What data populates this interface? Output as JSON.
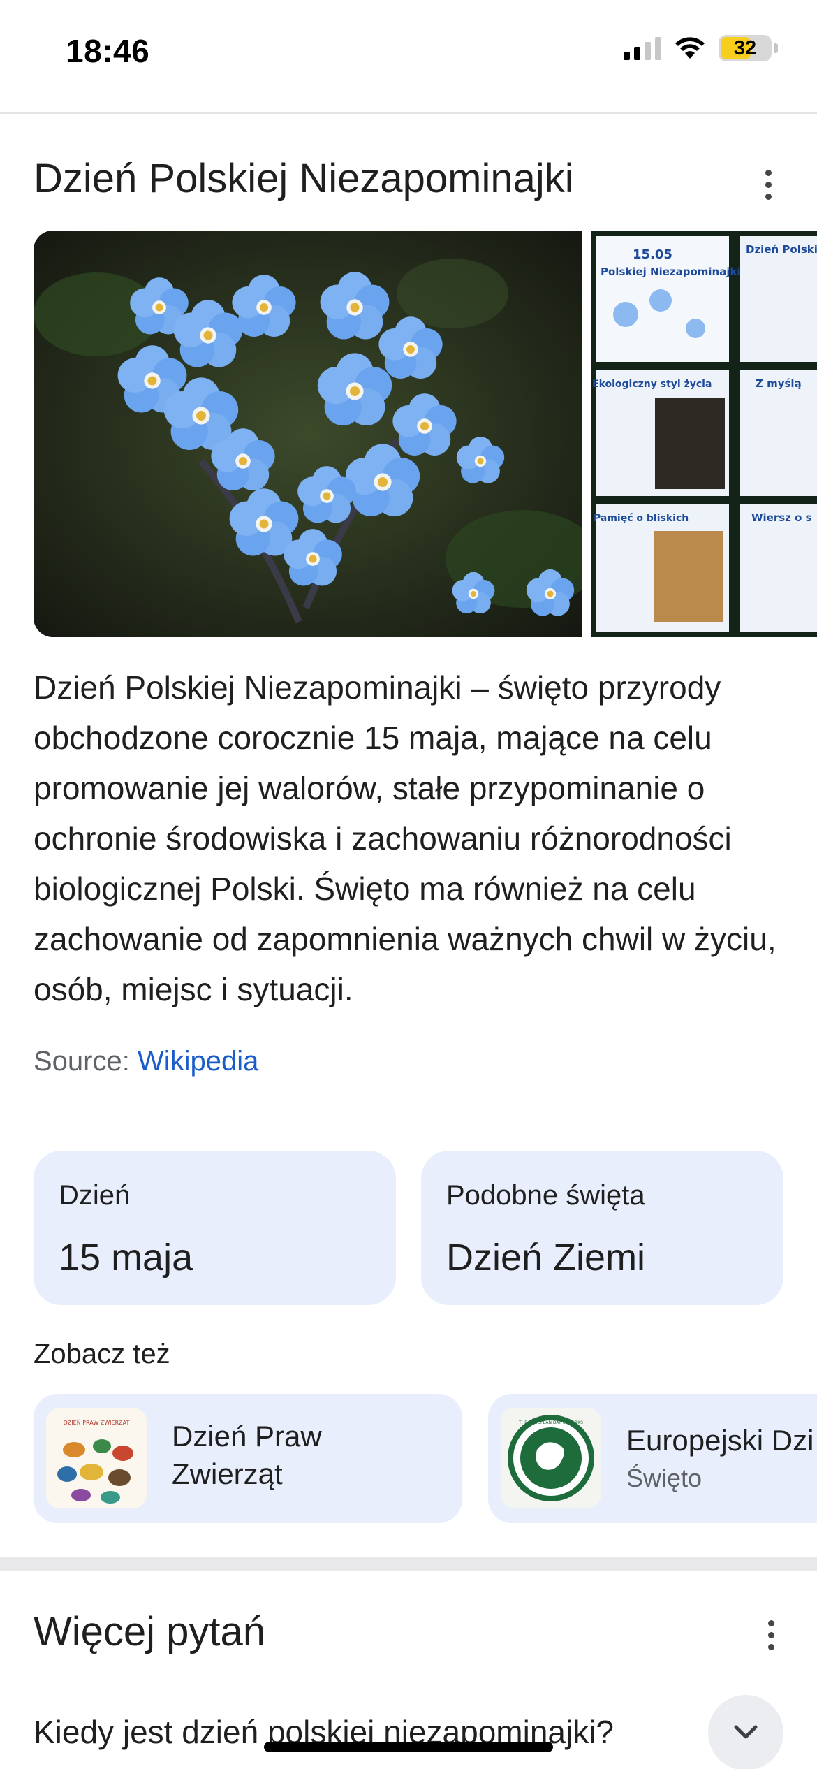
{
  "status_bar": {
    "time": "18:46",
    "battery": "32",
    "icons": [
      "cellular-signal-icon",
      "wifi-icon",
      "battery-icon"
    ]
  },
  "knowledge_panel": {
    "title": "Dzień Polskiej Niezapominajki",
    "images": [
      "forget-me-not heart",
      "15.05 Polskiej Niezapominajki"
    ],
    "poster_texts": [
      "15.05",
      "Polskiej Niezapominajki",
      "Dzień Polskiej",
      "Ekologiczny styl życia",
      "Z myślą",
      "Pamięć o bliskich",
      "Wiersz o s"
    ],
    "description": "Dzień Polskiej Niezapominajki – święto przyrody obchodzone corocznie 15 maja, mające na celu promowanie jej walorów, stałe przypominanie o ochronie środowiska i zachowaniu różnorodności biologicznej Polski. Święto ma również na celu zachowanie od zapomnienia ważnych chwil w życiu, osób, miejsc i sytuacji.",
    "source_label": "Source:",
    "source_link": "Wikipedia",
    "facts": [
      {
        "label": "Dzień",
        "value": "15 maja"
      },
      {
        "label": "Podobne święta",
        "value": "Dzień Ziemi"
      }
    ],
    "see_also_title": "Zobacz też",
    "see_also": [
      {
        "name": "Dzień Praw Zwierząt",
        "subtitle": ""
      },
      {
        "name": "Europejski Dzi",
        "subtitle": "Święto"
      }
    ],
    "thumb_texts": [
      "DZIEŃ PRAW ZWIERZĄT",
      "THE EUROPEAN DAY OF PARKS"
    ]
  },
  "more_questions": {
    "title": "Więcej pytań",
    "questions": [
      "Kiedy jest dzień polskiej niezapominajki?"
    ]
  },
  "colors": {
    "card_background": "#e8eefc",
    "link": "#1a5cc8",
    "flower_blue": "#6ea8ef",
    "battery_yellow": "#f7cd1e"
  }
}
